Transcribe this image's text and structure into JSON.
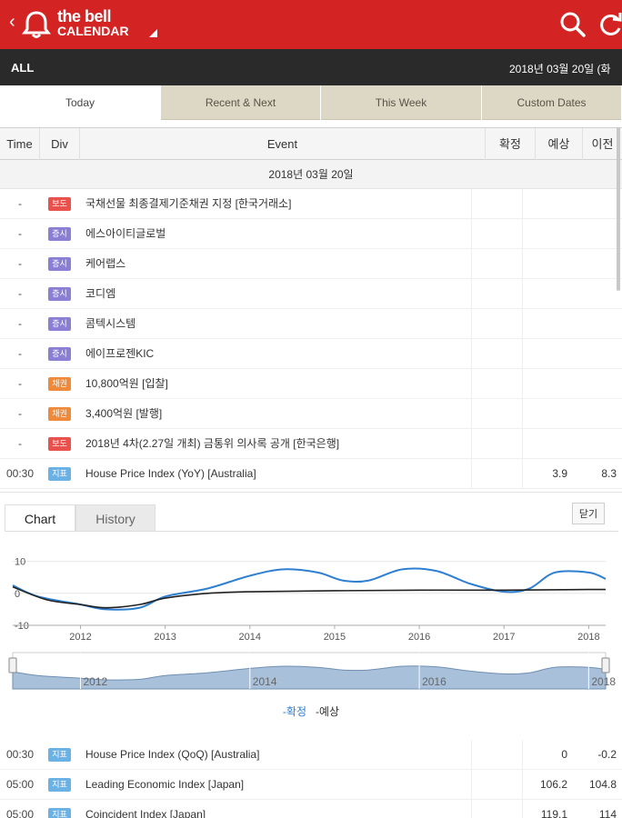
{
  "header": {
    "back_glyph": "‹",
    "brand_line1": "the bell",
    "brand_line2": "CALENDAR",
    "icons": [
      "bell-icon",
      "search-icon",
      "refresh-icon"
    ],
    "accent_color": "#d42323"
  },
  "filterbar": {
    "label": "ALL",
    "date": "2018년 03월 20일 (화"
  },
  "tabs": [
    {
      "label": "Today",
      "active": true
    },
    {
      "label": "Recent & Next",
      "active": false
    },
    {
      "label": "This Week",
      "active": false
    },
    {
      "label": "Custom Dates",
      "active": false
    }
  ],
  "table": {
    "columns": [
      "Time",
      "Div",
      "Event",
      "확정",
      "예상",
      "이전"
    ],
    "date_group": "2018년 03월 20일",
    "rows": [
      {
        "time": "-",
        "div": "보도",
        "color": "red",
        "event": "국채선물 최종결제기준채권 지정 [한국거래소]",
        "confirmed": "",
        "forecast": "",
        "previous": ""
      },
      {
        "time": "-",
        "div": "증시",
        "color": "purple",
        "event": "에스아이티글로벌",
        "confirmed": "",
        "forecast": "",
        "previous": ""
      },
      {
        "time": "-",
        "div": "증시",
        "color": "purple",
        "event": "케어랩스",
        "confirmed": "",
        "forecast": "",
        "previous": ""
      },
      {
        "time": "-",
        "div": "증시",
        "color": "purple",
        "event": "코디엠",
        "confirmed": "",
        "forecast": "",
        "previous": ""
      },
      {
        "time": "-",
        "div": "증시",
        "color": "purple",
        "event": "콤텍시스템",
        "confirmed": "",
        "forecast": "",
        "previous": ""
      },
      {
        "time": "-",
        "div": "증시",
        "color": "purple",
        "event": "에이프로젠KIC",
        "confirmed": "",
        "forecast": "",
        "previous": ""
      },
      {
        "time": "-",
        "div": "채권",
        "color": "orange",
        "event": "10,800억원 [입찰]",
        "confirmed": "",
        "forecast": "",
        "previous": ""
      },
      {
        "time": "-",
        "div": "채권",
        "color": "orange",
        "event": "3,400억원 [발행]",
        "confirmed": "",
        "forecast": "",
        "previous": ""
      },
      {
        "time": "-",
        "div": "보도",
        "color": "red",
        "event": "2018년 4차(2.27일 개최) 금통위 의사록 공개 [한국은행]",
        "confirmed": "",
        "forecast": "",
        "previous": ""
      },
      {
        "time": "00:30",
        "div": "지표",
        "color": "blue",
        "event": "House Price Index (YoY) [Australia]",
        "confirmed": "",
        "forecast": "3.9",
        "previous": "8.3"
      }
    ],
    "rows_after": [
      {
        "time": "00:30",
        "div": "지표",
        "color": "blue",
        "event": "House Price Index (QoQ) [Australia]",
        "confirmed": "",
        "forecast": "0",
        "previous": "-0.2"
      },
      {
        "time": "05:00",
        "div": "지표",
        "color": "blue",
        "event": "Leading Economic Index [Japan]",
        "confirmed": "",
        "forecast": "106.2",
        "previous": "104.8"
      },
      {
        "time": "05:00",
        "div": "지표",
        "color": "blue",
        "event": "Coincident Index [Japan]",
        "confirmed": "",
        "forecast": "119.1",
        "previous": "114"
      }
    ]
  },
  "chart_panel": {
    "tabs": [
      "Chart",
      "History"
    ],
    "close_label": "닫기",
    "legend_confirmed": "-확정",
    "legend_forecast": "-예상"
  },
  "chart_data": {
    "type": "line",
    "x_ticks": [
      "2012",
      "2013",
      "2014",
      "2015",
      "2016",
      "2017",
      "2018"
    ],
    "y_ticks": [
      "10",
      "0",
      "-10"
    ],
    "ylim": [
      -10,
      15
    ],
    "navigator_ticks": [
      "2012",
      "2014",
      "2016",
      "2018"
    ],
    "series": [
      {
        "name": "확정",
        "color": "#2e7fd0",
        "x": [
          2011.2,
          2011.5,
          2012.0,
          2012.3,
          2012.7,
          2013.0,
          2013.5,
          2014.0,
          2014.4,
          2014.8,
          2015.1,
          2015.4,
          2015.8,
          2016.2,
          2016.6,
          2017.0,
          2017.3,
          2017.6,
          2018.0,
          2018.2
        ],
        "y": [
          2.5,
          -1.0,
          -3.5,
          -5.0,
          -4.5,
          -1.0,
          1.5,
          5.5,
          7.5,
          6.5,
          4.0,
          4.0,
          7.5,
          7.0,
          3.0,
          0.5,
          1.5,
          6.5,
          6.5,
          4.5
        ]
      },
      {
        "name": "예상",
        "color": "#222222",
        "x": [
          2011.2,
          2011.6,
          2012.0,
          2012.3,
          2012.7,
          2013.0,
          2013.5,
          2014.0,
          2015.0,
          2016.0,
          2017.0,
          2018.0,
          2018.2
        ],
        "y": [
          2.0,
          -2.0,
          -3.5,
          -4.5,
          -3.5,
          -1.5,
          0.0,
          0.5,
          0.8,
          1.0,
          1.0,
          1.2,
          1.2
        ]
      }
    ]
  }
}
